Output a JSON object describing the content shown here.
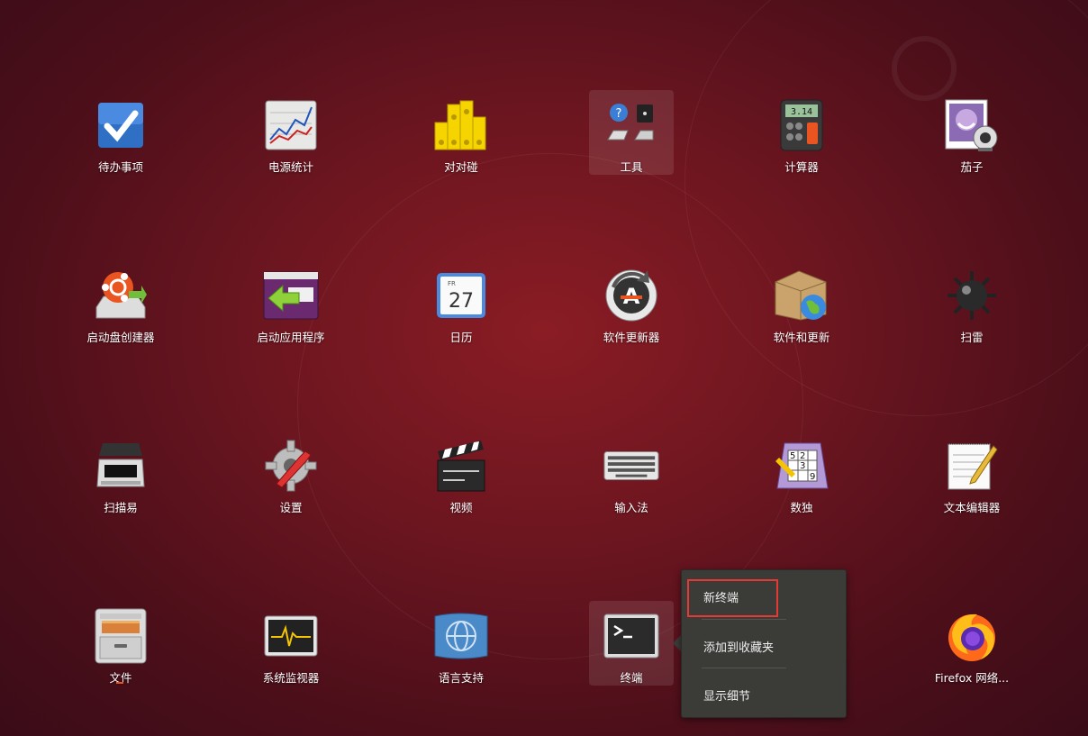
{
  "apps": [
    {
      "label": "待办事项",
      "icon": "todo-check-icon"
    },
    {
      "label": "电源统计",
      "icon": "power-statistics-icon"
    },
    {
      "label": "对对碰",
      "icon": "swell-foop-icon"
    },
    {
      "label": "工具",
      "icon": "utilities-folder-icon"
    },
    {
      "label": "计算器",
      "icon": "calculator-icon"
    },
    {
      "label": "茄子",
      "icon": "cheese-webcam-icon"
    },
    {
      "label": "启动盘创建器",
      "icon": "startup-disk-creator-icon"
    },
    {
      "label": "启动应用程序",
      "icon": "startup-applications-icon"
    },
    {
      "label": "日历",
      "icon": "calendar-icon"
    },
    {
      "label": "软件更新器",
      "icon": "software-updater-icon"
    },
    {
      "label": "软件和更新",
      "icon": "software-and-updates-icon"
    },
    {
      "label": "扫雷",
      "icon": "mines-icon"
    },
    {
      "label": "扫描易",
      "icon": "scanner-icon"
    },
    {
      "label": "设置",
      "icon": "settings-gear-icon"
    },
    {
      "label": "视频",
      "icon": "video-clapper-icon"
    },
    {
      "label": "输入法",
      "icon": "keyboard-icon"
    },
    {
      "label": "数独",
      "icon": "sudoku-icon"
    },
    {
      "label": "文本编辑器",
      "icon": "text-editor-icon"
    },
    {
      "label": "文件",
      "icon": "files-cabinet-icon"
    },
    {
      "label": "系统监视器",
      "icon": "system-monitor-icon"
    },
    {
      "label": "语言支持",
      "icon": "language-support-icon"
    },
    {
      "label": "终端",
      "icon": "terminal-icon"
    },
    {
      "label": "",
      "icon": ""
    },
    {
      "label": "Firefox 网络...",
      "icon": "firefox-icon"
    }
  ],
  "calendar": {
    "weekday": "FR",
    "day": "27"
  },
  "calculator": {
    "display": "3.14"
  },
  "sudoku": {
    "cells": [
      "5",
      "2",
      "3",
      "9"
    ]
  },
  "context_menu": {
    "items": [
      "新终端",
      "添加到收藏夹",
      "显示细节"
    ]
  },
  "colors": {
    "accent": "#e95420",
    "highlight_box": "#e53935"
  }
}
